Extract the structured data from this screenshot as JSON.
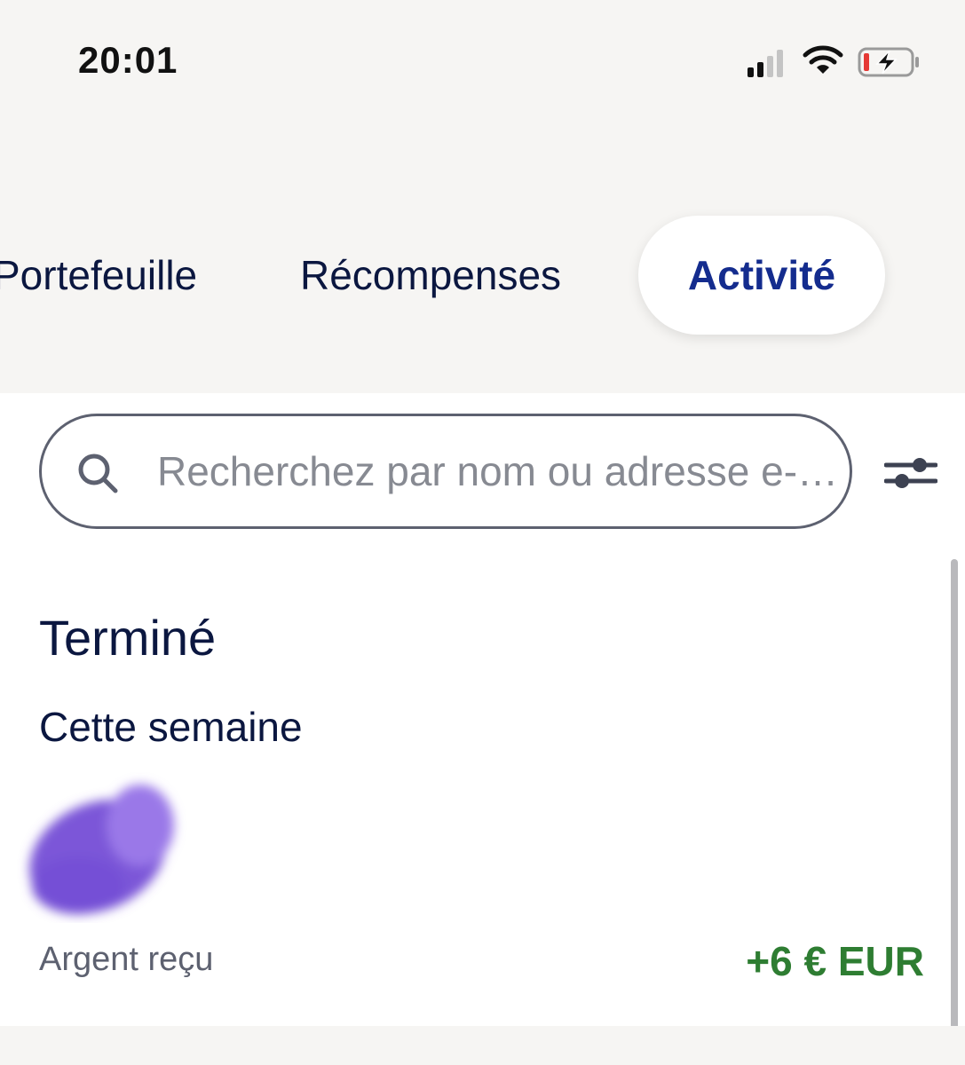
{
  "status_bar": {
    "time": "20:01",
    "signal_icon": "signal-icon",
    "wifi_icon": "wifi-icon",
    "battery_icon": "battery-charging-icon"
  },
  "tabs": [
    {
      "label": "Portefeuille",
      "active": false
    },
    {
      "label": "Récompenses",
      "active": false
    },
    {
      "label": "Activité",
      "active": true
    }
  ],
  "search": {
    "placeholder": "Recherchez par nom ou adresse e-mail",
    "icon": "search-icon",
    "filter_icon": "filter-sliders-icon"
  },
  "activity": {
    "section_title": "Terminé",
    "groups": [
      {
        "title": "Cette semaine",
        "transactions": [
          {
            "label": "Argent reçu",
            "amount": "+6 € EUR",
            "avatar": "blurred-avatar"
          }
        ]
      }
    ]
  },
  "colors": {
    "background_top": "#f6f5f3",
    "text_primary": "#0b1740",
    "active_tab_text": "#142c8e",
    "amount_positive": "#2e7d32",
    "avatar_purple": "#7b56d8"
  }
}
